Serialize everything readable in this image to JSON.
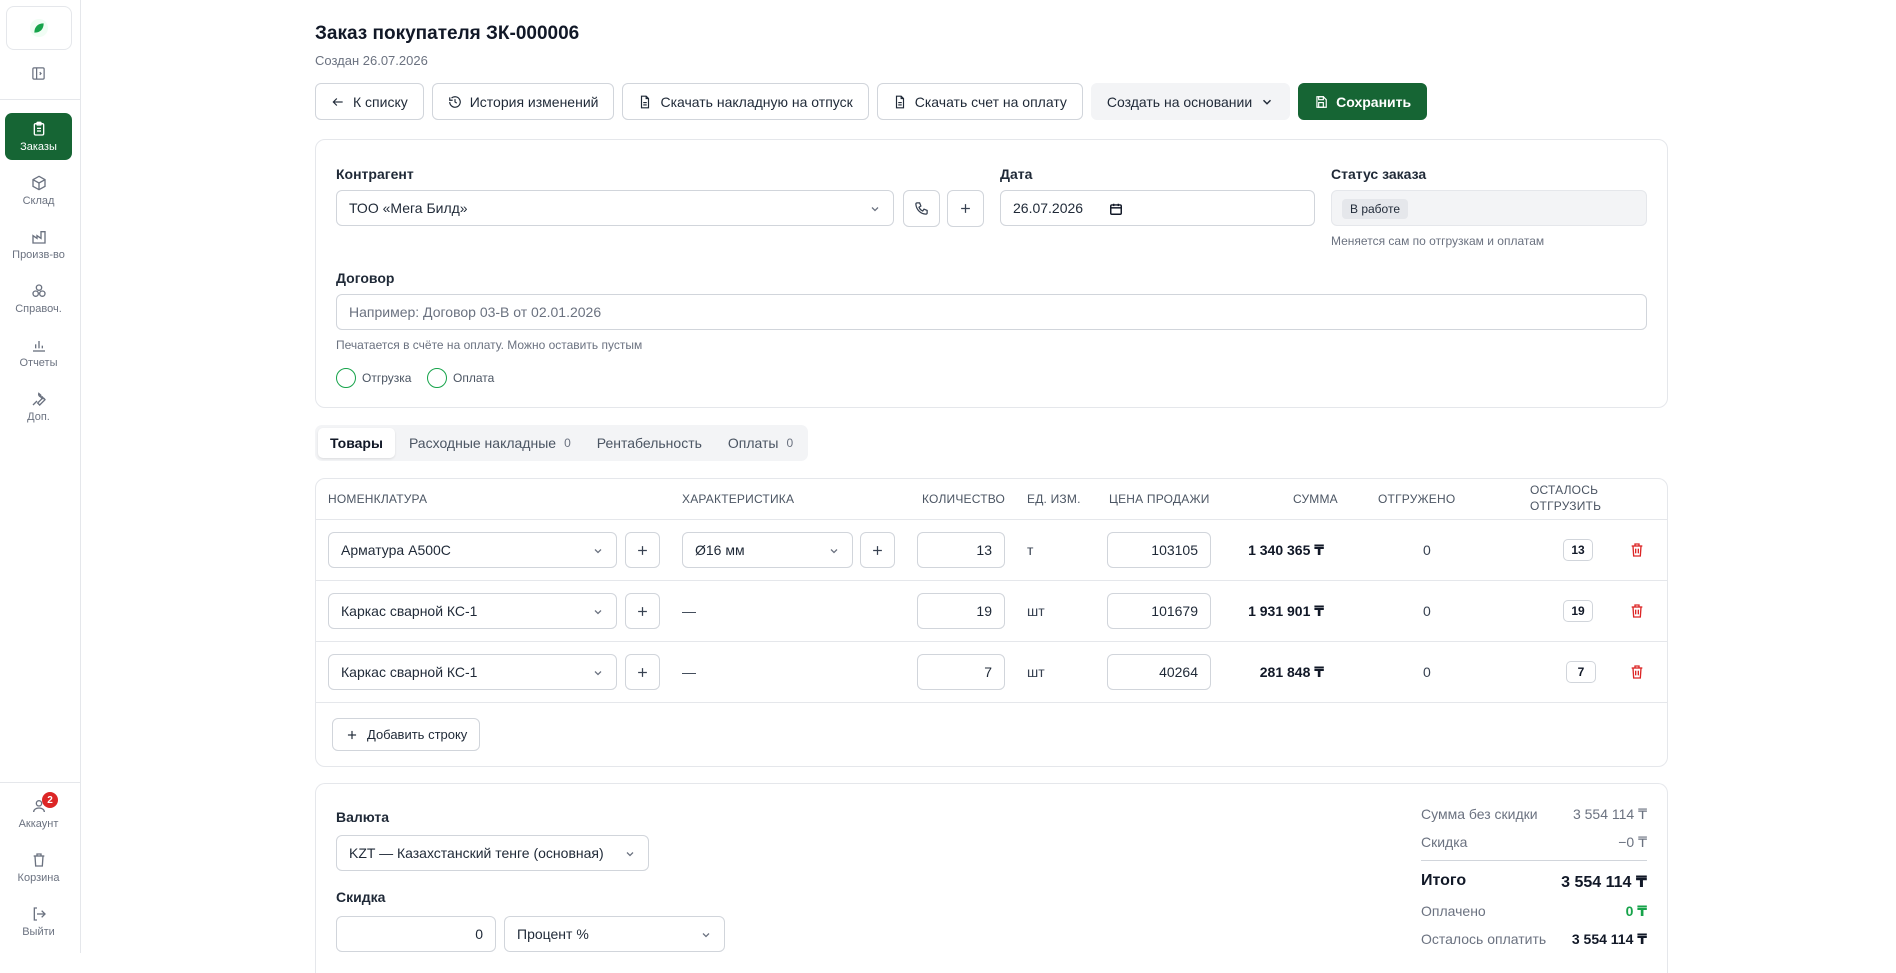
{
  "sidebar": {
    "items": [
      {
        "label": "Заказы",
        "icon": "clipboard-icon",
        "active": true
      },
      {
        "label": "Склад",
        "icon": "box-icon",
        "active": false
      },
      {
        "label": "Произв-во",
        "icon": "factory-icon",
        "active": false
      },
      {
        "label": "Справоч.",
        "icon": "boxes-icon",
        "active": false
      },
      {
        "label": "Отчеты",
        "icon": "bar-chart-icon",
        "active": false
      },
      {
        "label": "Доп.",
        "icon": "wrench-icon",
        "active": false
      }
    ],
    "bottom": [
      {
        "label": "Аккаунт",
        "icon": "user-icon",
        "badge": "2"
      },
      {
        "label": "Корзина",
        "icon": "trash-icon"
      },
      {
        "label": "Выйти",
        "icon": "logout-icon"
      }
    ]
  },
  "header": {
    "title": "Заказ покупателя ЗК-000006",
    "subtitle": "Создан 26.07.2026"
  },
  "toolbar": {
    "back": "К списку",
    "history": "История изменений",
    "download_invoice": "Скачать накладную на отпуск",
    "download_bill": "Скачать счет на оплату",
    "create_based": "Создать на основании",
    "save": "Сохранить"
  },
  "form": {
    "counterparty_label": "Контрагент",
    "counterparty_value": "ТОО «Мега Билд»",
    "date_label": "Дата",
    "date_value": "26.07.2026",
    "status_label": "Статус заказа",
    "status_value": "В работе",
    "status_hint": "Меняется сам по отгрузкам и оплатам",
    "contract_label": "Договор",
    "contract_placeholder": "Например: Договор 03-В от 02.01.2026",
    "contract_hint": "Печатается в счёте на оплату. Можно оставить пустым",
    "radio_shipment": "Отгрузка",
    "radio_payment": "Оплата"
  },
  "tabs": [
    {
      "label": "Товары",
      "count": ""
    },
    {
      "label": "Расходные накладные",
      "count": "0"
    },
    {
      "label": "Рентабельность",
      "count": ""
    },
    {
      "label": "Оплаты",
      "count": "0"
    }
  ],
  "table": {
    "headers": {
      "item": "Номенклатура",
      "characteristic": "Характеристика",
      "qty": "Количество",
      "unit": "Ед. изм.",
      "price": "Цена продажи",
      "sum": "Сумма",
      "shipped": "Отгружено",
      "remain_1": "Осталось",
      "remain_2": "отгрузить"
    },
    "rows": [
      {
        "item": "Арматура А500С",
        "characteristic": "Ø16 мм",
        "qty": "13",
        "unit": "т",
        "price": "103105",
        "sum": "1 340 365 ₸",
        "shipped": "0",
        "remain": "13"
      },
      {
        "item": "Каркас сварной КС-1",
        "characteristic": "—",
        "qty": "19",
        "unit": "шт",
        "price": "101679",
        "sum": "1 931 901 ₸",
        "shipped": "0",
        "remain": "19"
      },
      {
        "item": "Каркас сварной КС-1",
        "characteristic": "—",
        "qty": "7",
        "unit": "шт",
        "price": "40264",
        "sum": "281 848 ₸",
        "shipped": "0",
        "remain": "7"
      }
    ],
    "add_row": "Добавить строку"
  },
  "footer": {
    "currency_label": "Валюта",
    "currency_value": "KZT — Казахстанский тенге (основная)",
    "discount_label": "Скидка",
    "discount_value": "0",
    "discount_type": "Процент %",
    "totals": {
      "sum_no_discount_label": "Сумма без скидки",
      "sum_no_discount": "3 554 114 ₸",
      "discount_label": "Скидка",
      "discount": "−0 ₸",
      "total_label": "Итого",
      "total": "3 554 114 ₸",
      "paid_label": "Оплачено",
      "paid": "0 ₸",
      "remaining_label": "Осталось оплатить",
      "remaining": "3 554 114 ₸"
    }
  },
  "colors": {
    "accent": "#166534",
    "danger": "#dc2626",
    "paid": "#16a34a"
  }
}
